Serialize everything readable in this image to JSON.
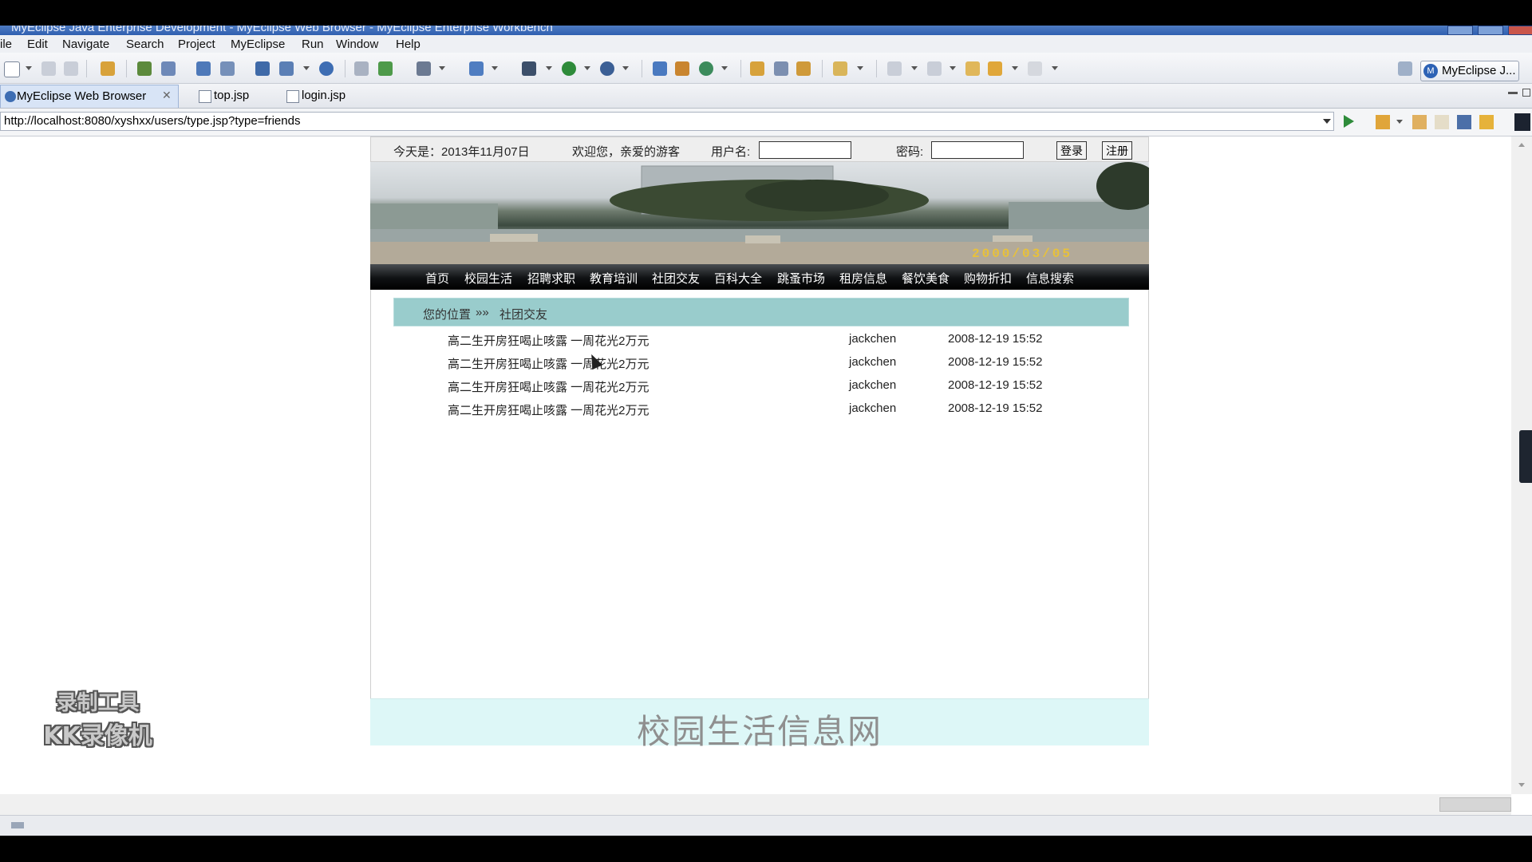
{
  "window": {
    "title": "MyEclipse Java Enterprise Development - MyEclipse Web Browser - MyEclipse Enterprise Workbench"
  },
  "menu": [
    "ile",
    "Edit",
    "Navigate",
    "Search",
    "Project",
    "MyEclipse",
    "Run",
    "Window",
    "Help"
  ],
  "perspective": {
    "label": "MyEclipse J..."
  },
  "tabs": [
    {
      "label": "MyEclipse Web Browser",
      "close": "✕"
    },
    {
      "label": "top.jsp"
    },
    {
      "label": "login.jsp"
    }
  ],
  "browser": {
    "url": "http://localhost:8080/xyshxx/users/type.jsp?type=friends"
  },
  "site": {
    "login": {
      "date": "今天是：2013年11月07日",
      "welcome": "欢迎您，亲爱的游客",
      "username_label": "用户名:",
      "password_label": "密码:",
      "login_button": "登录",
      "register_button": "注册"
    },
    "banner_date": "2000/03/05",
    "nav": [
      "首页",
      "校园生活",
      "招聘求职",
      "教育培训",
      "社团交友",
      "百科大全",
      "跳蚤市场",
      "租房信息",
      "餐饮美食",
      "购物折扣",
      "信息搜索"
    ],
    "breadcrumb": {
      "label": "您的位置",
      "sep": "»»",
      "current": "社团交友"
    },
    "posts": [
      {
        "title": "高二生开房狂喝止咳露 一周花光2万元",
        "author": "jackchen",
        "time": "2008-12-19 15:52"
      },
      {
        "title": "高二生开房狂喝止咳露 一周花光2万元",
        "author": "jackchen",
        "time": "2008-12-19 15:52"
      },
      {
        "title": "高二生开房狂喝止咳露 一周花光2万元",
        "author": "jackchen",
        "time": "2008-12-19 15:52"
      },
      {
        "title": "高二生开房狂喝止咳露 一周花光2万元",
        "author": "jackchen",
        "time": "2008-12-19 15:52"
      }
    ],
    "footer": "校园生活信息网"
  },
  "watermark": {
    "line1": "录制工具",
    "line2": "KK录像机"
  }
}
